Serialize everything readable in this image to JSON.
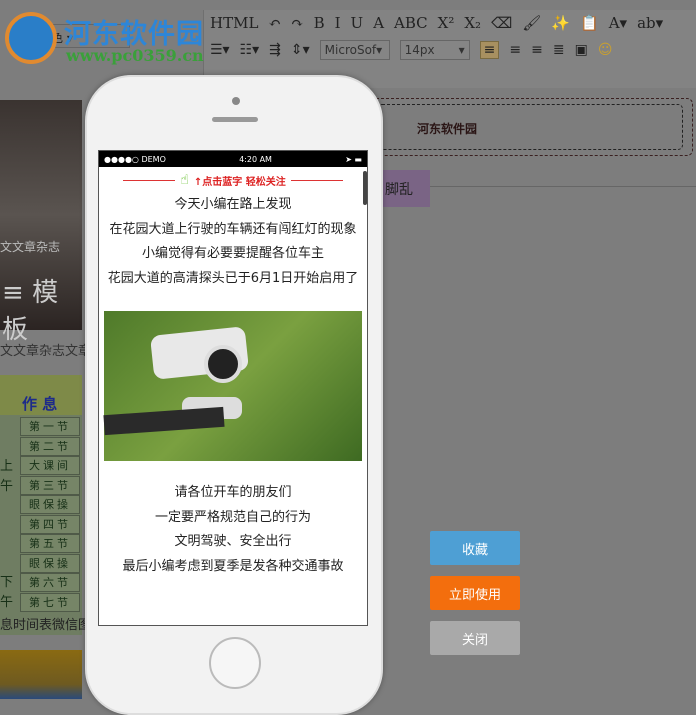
{
  "watermark": {
    "title": "河东软件园",
    "url": "www.pc0359.cn"
  },
  "editor": {
    "color_select": "换色",
    "font_family": "MicroSof",
    "font_size": "14px",
    "toolbar_row1": [
      "HTML",
      "↶",
      "↷",
      "B",
      "I",
      "U",
      "A",
      "ABC",
      "X²",
      "X₂",
      "⌫",
      "🖌",
      "✨",
      "📋",
      "A▾",
      "ab▾"
    ],
    "preview_title": "河东软件园",
    "tag": "脚乱"
  },
  "left": {
    "banner_caption": "文文章杂志",
    "banner_title": "模板",
    "article_title": "文文章杂志文章",
    "table_header": "作 息",
    "table_rows": [
      "第一节",
      "第二节",
      "大课间",
      "第三节",
      "眼保操",
      "第四节",
      "第五节",
      "眼保操",
      "第六节",
      "第七节"
    ],
    "side_chars": [
      "上",
      "午",
      "下",
      "午"
    ],
    "caption": "息时间表微信图"
  },
  "phone": {
    "status": {
      "carrier": "●●●●○ DEMO",
      "time": "4:20 AM"
    },
    "follow_banner": "↑点击蓝字 轻松关注",
    "paragraphs": [
      "今天小编在路上发现",
      "在花园大道上行驶的车辆还有闯红灯的现象",
      "小编觉得有必要要提醒各位车主",
      "花园大道的高清探头已于6月1日开始启用了"
    ],
    "paragraphs2": [
      "请各位开车的朋友们",
      "一定要严格规范自己的行为",
      "文明驾驶、安全出行",
      "最后小编考虑到夏季是发各种交通事故"
    ]
  },
  "actions": {
    "favorite": "收藏",
    "use_now": "立即使用",
    "close": "关闭"
  },
  "colors": {
    "favorite": "#4e9fd4",
    "use_now": "#f36e0d",
    "close": "#a9a9a9"
  }
}
